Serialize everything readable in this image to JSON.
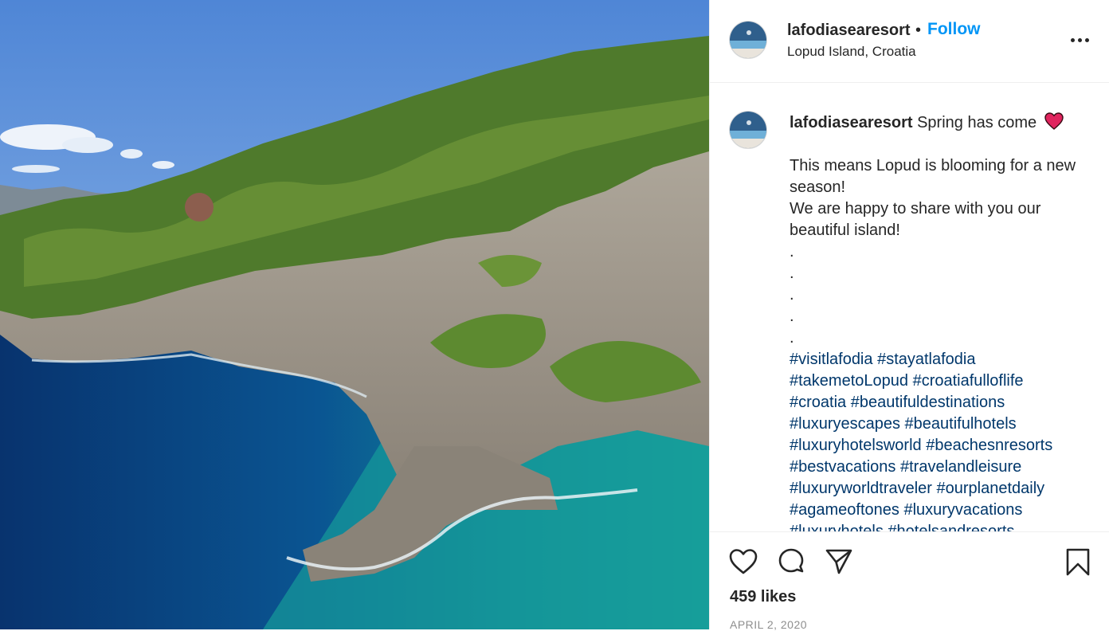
{
  "post": {
    "username": "lafodiasearesort",
    "dot": "•",
    "follow_label": "Follow",
    "location": "Lopud Island, Croatia"
  },
  "caption": {
    "username": "lafodiasearesort",
    "title": "Spring has come",
    "lines": [
      "This means Lopud is blooming for a new season!",
      "We are happy to share with you our beautiful island!",
      ".",
      ".",
      ".",
      ".",
      "."
    ],
    "hashtags": [
      "#visitlafodia",
      "#stayatlafodia",
      "#takemetoLopud",
      "#croatiafulloflife",
      "#croatia",
      "#beautifuldestinations",
      "#luxuryescapes",
      "#beautifulhotels",
      "#luxuryhotelsworld",
      "#beachesnresorts",
      "#bestvacations",
      "#travelandleisure",
      "#luxuryworldtraveler",
      "#ourplanetdaily",
      "#agameoftones",
      "#luxuryvacations",
      "#luxuryhotels",
      "#hotelsandresorts"
    ]
  },
  "actions": {
    "likes": "459 likes",
    "date": "APRIL 2, 2020"
  },
  "icons": {
    "like": "heart-outline-icon",
    "comment": "comment-bubble-icon",
    "share": "paper-plane-icon",
    "save": "bookmark-icon",
    "more": "more-options-icon"
  },
  "colors": {
    "link": "#0095f6",
    "hashtag": "#00376b",
    "muted": "#8e8e8e"
  }
}
